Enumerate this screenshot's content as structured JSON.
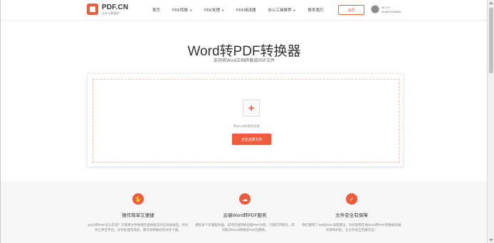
{
  "header": {
    "logo_name": "PDF.CN",
    "logo_slogan": "让办公更轻松！",
    "nav": [
      {
        "label": "首页",
        "caret": false
      },
      {
        "label": "PDF转换",
        "caret": true
      },
      {
        "label": "PDF处理",
        "caret": true
      },
      {
        "label": "PDF阅读器",
        "caret": false
      },
      {
        "label": "办公工具推荐",
        "caret": true
      },
      {
        "label": "联系我们",
        "caret": false
      }
    ],
    "member_button": "会员",
    "user_name": "W X H",
    "user_id": "ID:@02429406"
  },
  "main": {
    "title": "Word转PDF转换器",
    "subtitle": "支持将Word文档转换成PDF文件",
    "drop_hint": "将Word拖拽到此处",
    "select_button": "点击选择文件",
    "plus_icon": "+"
  },
  "features": [
    {
      "icon": "hand-pointer-icon",
      "glyph": "✋",
      "title": "操作简单又便捷",
      "desc": "Word转PDF怎么实现？只需将文件拖拽至虚线框或点击添加按钮，将文件上传至平台，文件处理完成后，便可将转换后的文件下载。"
    },
    {
      "icon": "cloud-icon",
      "glyph": "☁",
      "title": "云端Word转PDF服务",
      "desc": "拥有多个云端服务器，支持在线转换处理PDF文档，只需打开网页，即可解决Word转换成PDF的需要。"
    },
    {
      "icon": "shield-icon",
      "glyph": "✓",
      "title": "文件安全有保障",
      "desc": "我们使用了256位SSL加密算法，为您使用在线Word转PDF转换器的服务保驾护航，让文件安全无懈可击！"
    }
  ],
  "colors": {
    "accent": "#ef5b3c"
  }
}
